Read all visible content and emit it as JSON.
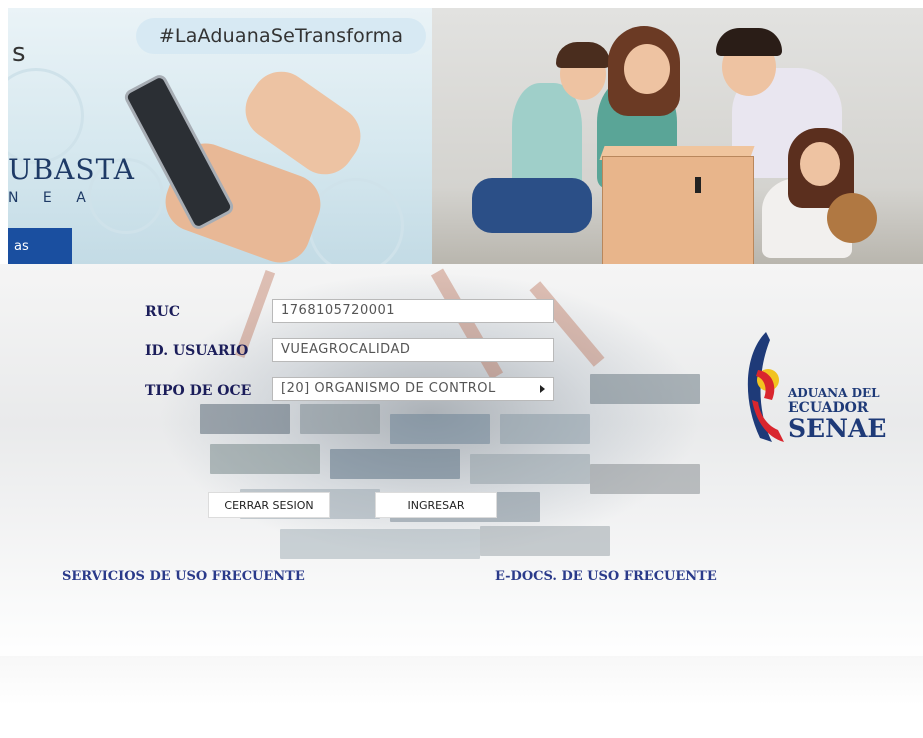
{
  "banner_left": {
    "hashtag": "#LaAduanaSeTransforma",
    "partial_word": "s",
    "subasta": "UBASTA",
    "subasta_sub": "N E A",
    "tab_text": "as"
  },
  "form": {
    "ruc_label": "RUC",
    "ruc_value": "1768105720001",
    "usuario_label": "ID. USUARIO",
    "usuario_value": "VUEAGROCALIDAD",
    "tipo_label": "TIPO DE OCE",
    "tipo_value": "[20] ORGANISMO DE CONTROL"
  },
  "buttons": {
    "cerrar": "CERRAR SESION",
    "ingresar": "INGRESAR"
  },
  "links": {
    "servicios": "SERVICIOS DE USO FRECUENTE",
    "edocs": "E-DOCS. DE USO FRECUENTE"
  },
  "logo": {
    "line1": "ADUANA DEL",
    "line2": "ECUADOR",
    "line3": "SENAE"
  },
  "colors": {
    "label": "#1b1d5a",
    "link": "#2a3a8a",
    "logo_blue": "#1e3a78",
    "logo_red": "#d9262e",
    "logo_yellow": "#f2c320"
  }
}
